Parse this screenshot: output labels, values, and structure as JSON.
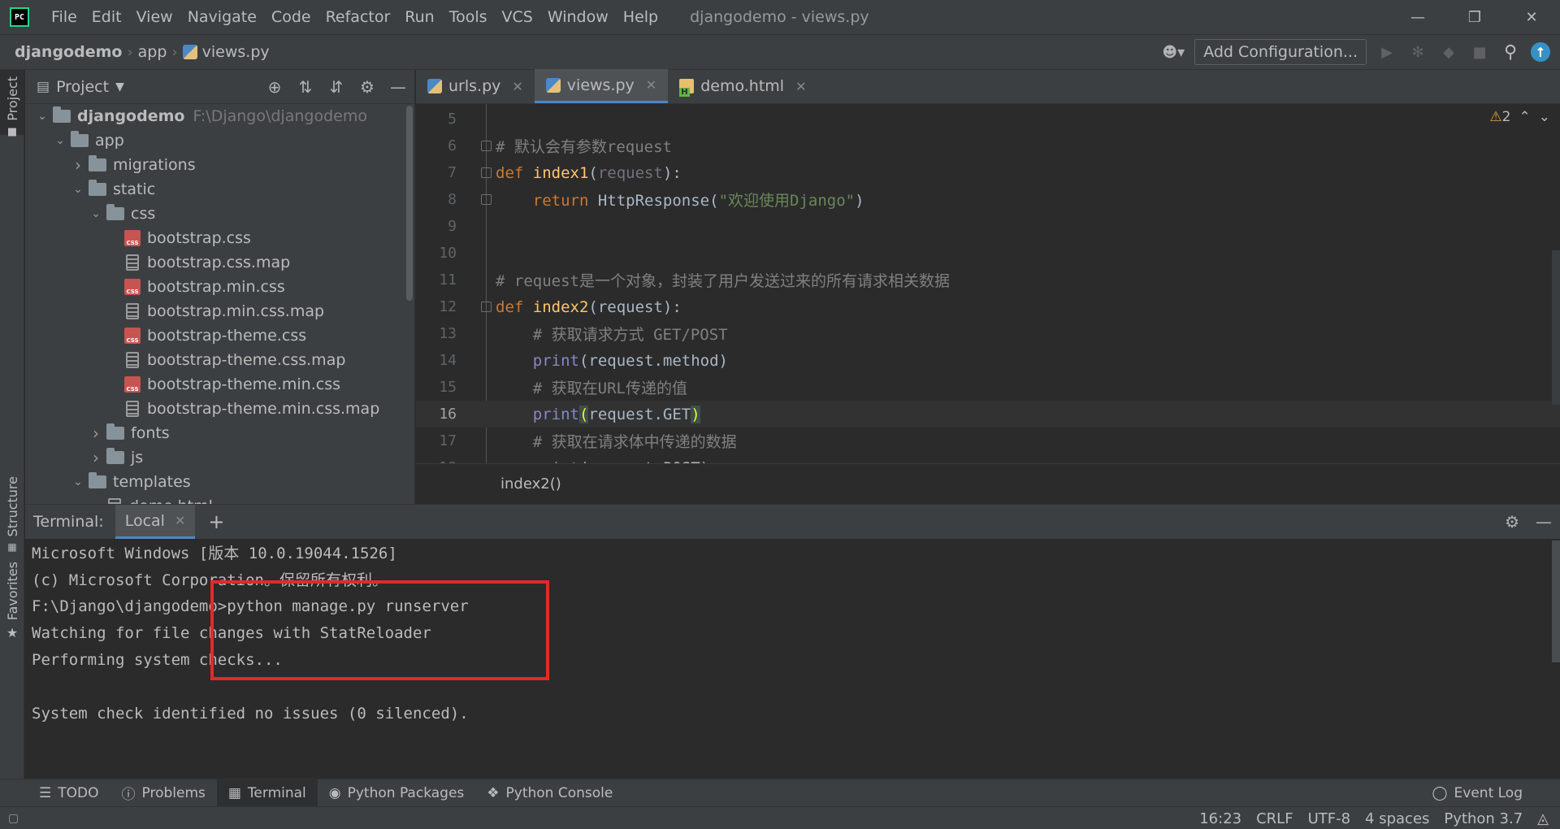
{
  "app": {
    "logo_text": "PC",
    "window_title": "djangodemo - views.py",
    "menu": [
      "File",
      "Edit",
      "View",
      "Navigate",
      "Code",
      "Refactor",
      "Run",
      "Tools",
      "VCS",
      "Window",
      "Help"
    ]
  },
  "navbar": {
    "breadcrumbs": [
      "djangodemo",
      "app",
      "views.py"
    ],
    "add_configuration": "Add Configuration..."
  },
  "left_strip": {
    "project": "Project",
    "structure": "Structure",
    "favorites": "Favorites"
  },
  "project_panel": {
    "title": "Project",
    "tree": [
      {
        "label": "djangodemo",
        "path": "F:\\Django\\djangodemo",
        "type": "folder",
        "depth": 0,
        "expanded": true,
        "bold": true
      },
      {
        "label": "app",
        "type": "folder",
        "depth": 1,
        "expanded": true
      },
      {
        "label": "migrations",
        "type": "folder",
        "depth": 2,
        "expanded": false
      },
      {
        "label": "static",
        "type": "folder",
        "depth": 2,
        "expanded": true
      },
      {
        "label": "css",
        "type": "folder",
        "depth": 3,
        "expanded": true
      },
      {
        "label": "bootstrap.css",
        "type": "css",
        "depth": 4
      },
      {
        "label": "bootstrap.css.map",
        "type": "text",
        "depth": 4
      },
      {
        "label": "bootstrap.min.css",
        "type": "css",
        "depth": 4
      },
      {
        "label": "bootstrap.min.css.map",
        "type": "text",
        "depth": 4
      },
      {
        "label": "bootstrap-theme.css",
        "type": "css",
        "depth": 4
      },
      {
        "label": "bootstrap-theme.css.map",
        "type": "text",
        "depth": 4
      },
      {
        "label": "bootstrap-theme.min.css",
        "type": "css",
        "depth": 4
      },
      {
        "label": "bootstrap-theme.min.css.map",
        "type": "text",
        "depth": 4
      },
      {
        "label": "fonts",
        "type": "folder",
        "depth": 3,
        "expanded": false
      },
      {
        "label": "js",
        "type": "folder",
        "depth": 3,
        "expanded": false
      },
      {
        "label": "templates",
        "type": "folder",
        "depth": 2,
        "expanded": true
      },
      {
        "label": "demo.html",
        "type": "text",
        "depth": 3
      }
    ]
  },
  "editor": {
    "tabs": [
      {
        "label": "urls.py",
        "icon": "python-file-icon",
        "active": false
      },
      {
        "label": "views.py",
        "icon": "python-file-icon",
        "active": true
      },
      {
        "label": "demo.html",
        "icon": "html-file-icon",
        "active": false
      }
    ],
    "warnings_count": "2",
    "current_line": 16,
    "lines": [
      {
        "n": "5",
        "segments": []
      },
      {
        "n": "6",
        "segments": [
          {
            "t": "# 默认会有参数request",
            "c": "cm"
          }
        ]
      },
      {
        "n": "7",
        "segments": [
          {
            "t": "def ",
            "c": "kw"
          },
          {
            "t": "index1",
            "c": "fn"
          },
          {
            "t": "(",
            "c": ""
          },
          {
            "t": "request",
            "c": "param"
          },
          {
            "t": "):",
            "c": ""
          }
        ]
      },
      {
        "n": "8",
        "segments": [
          {
            "t": "    ",
            "c": ""
          },
          {
            "t": "return ",
            "c": "kw"
          },
          {
            "t": "HttpResponse(",
            "c": ""
          },
          {
            "t": "\"欢迎使用Django\"",
            "c": "st"
          },
          {
            "t": ")",
            "c": ""
          }
        ]
      },
      {
        "n": "9",
        "segments": []
      },
      {
        "n": "10",
        "segments": []
      },
      {
        "n": "11",
        "segments": [
          {
            "t": "# request是一个对象，封装了用户发送过来的所有请求相关数据",
            "c": "cm"
          }
        ]
      },
      {
        "n": "12",
        "segments": [
          {
            "t": "def ",
            "c": "kw"
          },
          {
            "t": "index2",
            "c": "fn"
          },
          {
            "t": "(request):",
            "c": ""
          }
        ]
      },
      {
        "n": "13",
        "segments": [
          {
            "t": "    # 获取请求方式 GET/POST",
            "c": "cm"
          }
        ]
      },
      {
        "n": "14",
        "segments": [
          {
            "t": "    ",
            "c": ""
          },
          {
            "t": "print",
            "c": "bi"
          },
          {
            "t": "(request.method)",
            "c": ""
          }
        ]
      },
      {
        "n": "15",
        "segments": [
          {
            "t": "    # 获取在URL传递的值",
            "c": "cm"
          }
        ]
      },
      {
        "n": "16",
        "segments": [
          {
            "t": "    ",
            "c": ""
          },
          {
            "t": "print",
            "c": "bi"
          },
          {
            "t": "(",
            "c": "hl"
          },
          {
            "t": "request.GET",
            "c": ""
          },
          {
            "t": ")",
            "c": "hl"
          }
        ]
      },
      {
        "n": "17",
        "segments": [
          {
            "t": "    # 获取在请求体中传递的数据",
            "c": "cm"
          }
        ]
      },
      {
        "n": "18",
        "segments": [
          {
            "t": "    ",
            "c": ""
          },
          {
            "t": "print",
            "c": "bi"
          },
          {
            "t": "(request.POST)",
            "c": ""
          }
        ]
      }
    ],
    "footer_breadcrumb": "index2()"
  },
  "terminal": {
    "label": "Terminal:",
    "tab": "Local",
    "lines": [
      "Microsoft Windows [版本 10.0.19044.1526]",
      "(c) Microsoft Corporation。保留所有权利。",
      "F:\\Django\\djangodemo>python manage.py runserver",
      "Watching for file changes with StatReloader",
      "Performing system checks...",
      "",
      "System check identified no issues (0 silenced)."
    ]
  },
  "bottom_tools": [
    {
      "label": "TODO",
      "icon": "todo-list-icon",
      "active": false
    },
    {
      "label": "Problems",
      "icon": "problems-icon",
      "active": false
    },
    {
      "label": "Terminal",
      "icon": "terminal-icon",
      "active": true
    },
    {
      "label": "Python Packages",
      "icon": "packages-icon",
      "active": false
    },
    {
      "label": "Python Console",
      "icon": "python-console-icon",
      "active": false
    }
  ],
  "event_log": "Event Log",
  "status": {
    "position": "16:23",
    "line_separator": "CRLF",
    "encoding": "UTF-8",
    "indent": "4 spaces",
    "interpreter": "Python 3.7"
  },
  "colors": {
    "background": "#2b2b2b",
    "panel": "#3c3f41",
    "accent": "#4a88c7",
    "keyword": "#cc7832",
    "function": "#ffc66d",
    "comment": "#808080",
    "string": "#6a8759",
    "annotation_box": "#e02a2a"
  }
}
